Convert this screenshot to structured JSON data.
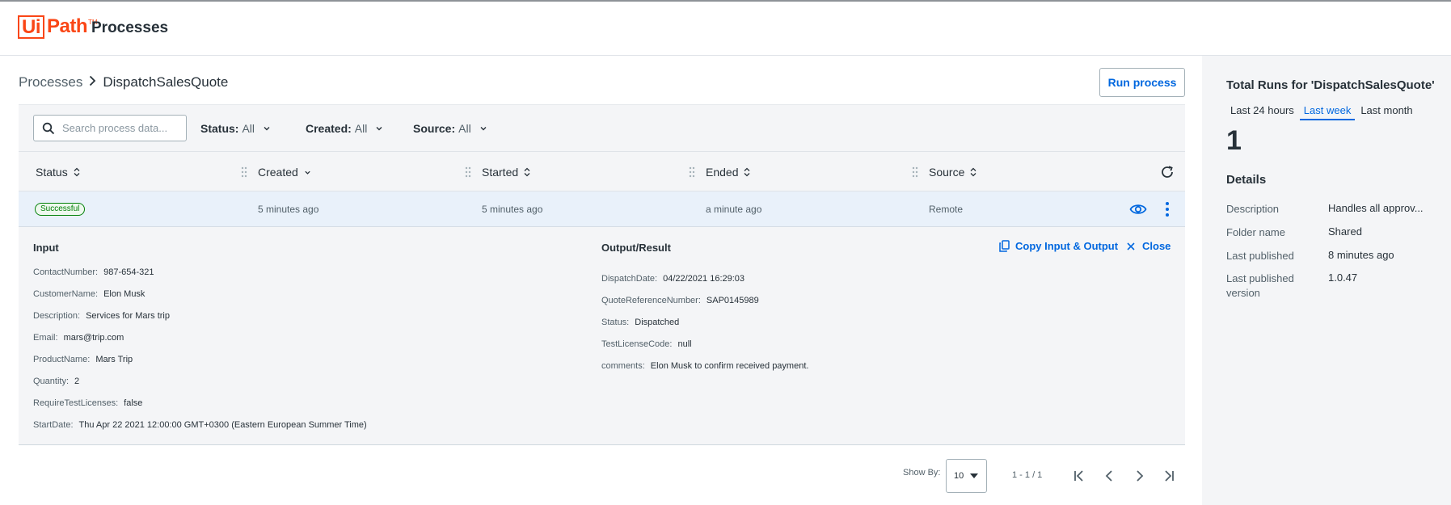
{
  "app": {
    "logo_ui": "Ui",
    "logo_path": "Path",
    "logo_tm": "TM",
    "title": "Processes"
  },
  "breadcrumb": {
    "root": "Processes",
    "current": "DispatchSalesQuote"
  },
  "actions": {
    "run_process": "Run process"
  },
  "filters": {
    "search_placeholder": "Search process data...",
    "status": {
      "label": "Status:",
      "value": "All"
    },
    "created": {
      "label": "Created:",
      "value": "All"
    },
    "source": {
      "label": "Source:",
      "value": "All"
    }
  },
  "table": {
    "columns": [
      "Status",
      "Created",
      "Started",
      "Ended",
      "Source"
    ],
    "rows": [
      {
        "status": "Successful",
        "created": "5 minutes ago",
        "started": "5 minutes ago",
        "ended": "a minute ago",
        "source": "Remote"
      }
    ]
  },
  "details": {
    "input_title": "Input",
    "output_title": "Output/Result",
    "copy_label": "Copy Input & Output",
    "close_label": "Close",
    "input": [
      {
        "key": "ContactNumber:",
        "value": "987-654-321"
      },
      {
        "key": "CustomerName:",
        "value": "Elon Musk"
      },
      {
        "key": "Description:",
        "value": "Services for Mars trip"
      },
      {
        "key": "Email:",
        "value": "mars@trip.com"
      },
      {
        "key": "ProductName:",
        "value": "Mars Trip"
      },
      {
        "key": "Quantity:",
        "value": "2"
      },
      {
        "key": "RequireTestLicenses:",
        "value": "false"
      },
      {
        "key": "StartDate:",
        "value": "Thu Apr 22 2021 12:00:00 GMT+0300 (Eastern European Summer Time)"
      }
    ],
    "output": [
      {
        "key": "DispatchDate:",
        "value": "04/22/2021 16:29:03"
      },
      {
        "key": "QuoteReferenceNumber:",
        "value": "SAP0145989"
      },
      {
        "key": "Status:",
        "value": "Dispatched"
      },
      {
        "key": "TestLicenseCode:",
        "value": "null"
      },
      {
        "key": "comments:",
        "value": "Elon Musk to confirm received payment."
      }
    ]
  },
  "pagination": {
    "show_by_label": "Show By:",
    "page_size": "10",
    "range": "1 - 1 / 1"
  },
  "side_panel": {
    "title": "Total Runs for 'DispatchSalesQuote'",
    "tabs": [
      "Last 24 hours",
      "Last week",
      "Last month"
    ],
    "active_tab": "Last week",
    "count": "1",
    "details_title": "Details",
    "details": [
      {
        "key": "Description",
        "value": "Handles all approv..."
      },
      {
        "key": "Folder name",
        "value": "Shared"
      },
      {
        "key": "Last published",
        "value": "8 minutes ago"
      },
      {
        "key": "Last published version",
        "value": "1.0.47"
      }
    ]
  },
  "colors": {
    "brand": "#fa4616",
    "accent": "#0067df",
    "success": "#038108"
  },
  "icons": [
    "search-icon",
    "chevron-down-icon",
    "sort-icon",
    "drag-handle-icon",
    "refresh-icon",
    "eye-icon",
    "more-vertical-icon",
    "copy-icon",
    "close-icon",
    "first-page-icon",
    "prev-page-icon",
    "next-page-icon",
    "last-page-icon"
  ]
}
